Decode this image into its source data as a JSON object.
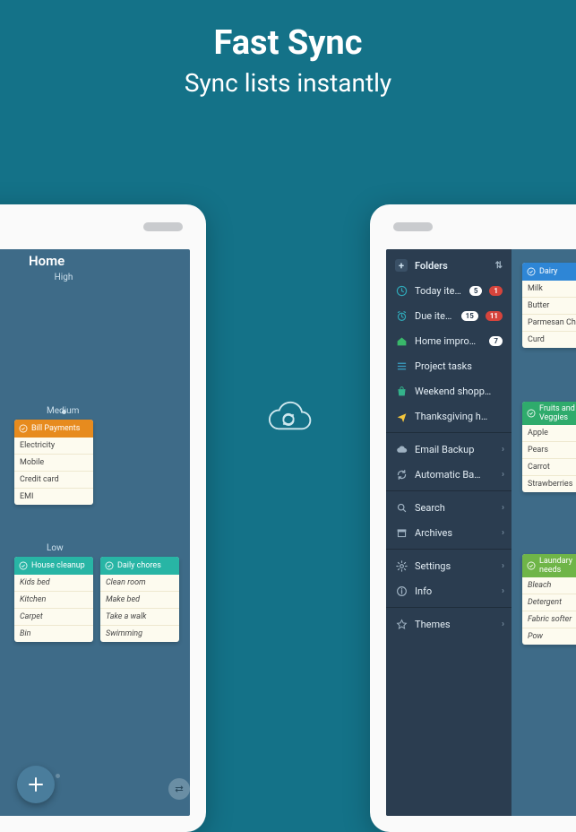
{
  "hero": {
    "title": "Fast Sync",
    "subtitle": "Sync lists instantly"
  },
  "left": {
    "title": "Home",
    "priorities": {
      "high": "High",
      "medium": "Medium",
      "low": "Low"
    },
    "cards": {
      "bill": {
        "color": "#e78b1e",
        "title": "Bill Payments",
        "items": [
          "Electricity",
          "Mobile",
          "Credit card",
          "EMI"
        ]
      },
      "house": {
        "color": "#28b5a5",
        "title": "House cleanup",
        "items": [
          "Kids bed",
          "Kitchen",
          "Carpet",
          "Bin"
        ]
      },
      "daily": {
        "color": "#28b5a5",
        "title": "Daily chores",
        "items": [
          "Clean room",
          "Make bed",
          "Take a walk",
          "Swimming"
        ]
      }
    }
  },
  "sidebar": {
    "folders_label": "Folders",
    "items": [
      {
        "icon": "clock",
        "label": "Today items",
        "badges": [
          "5",
          "1"
        ]
      },
      {
        "icon": "alarm",
        "label": "Due items",
        "badges": [
          "15",
          "11"
        ]
      },
      {
        "icon": "home",
        "label": "Home impro…",
        "badges": [
          "7"
        ]
      },
      {
        "icon": "project",
        "label": "Project tasks",
        "badges": []
      },
      {
        "icon": "bag",
        "label": "Weekend shopp…",
        "badges": []
      },
      {
        "icon": "plane",
        "label": "Thanksgiving h…",
        "badges": []
      }
    ],
    "backup": [
      {
        "icon": "cloud",
        "label": "Email Backup"
      },
      {
        "icon": "refresh",
        "label": "Automatic Ba…"
      }
    ],
    "tools": [
      {
        "icon": "search",
        "label": "Search"
      },
      {
        "icon": "archive",
        "label": "Archives"
      }
    ],
    "settings": [
      {
        "icon": "gear",
        "label": "Settings"
      },
      {
        "icon": "info",
        "label": "Info"
      }
    ],
    "themes": {
      "icon": "themes",
      "label": "Themes"
    }
  },
  "right_lists": {
    "dairy": {
      "color": "#2e86d6",
      "title": "Dairy",
      "items": [
        "Milk",
        "Butter",
        "Parmesan Che",
        "Curd"
      ]
    },
    "fruits": {
      "color": "#2fab6c",
      "title": "Fruits and Veggies",
      "items": [
        "Apple",
        "Pears",
        "Carrot",
        "Strawberries"
      ]
    },
    "laundry": {
      "color": "#6fb548",
      "title": "Laundary needs",
      "items": [
        "Bleach",
        "Detergent",
        "Fabric softer",
        "Pow"
      ]
    }
  }
}
